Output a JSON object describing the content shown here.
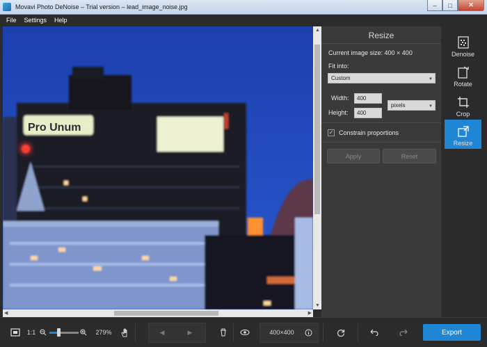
{
  "window": {
    "title": "Movavi Photo DeNoise – Trial version – lead_image_noise.jpg",
    "minimize": "–",
    "maximize": "□",
    "close": "✕"
  },
  "menu": {
    "items": [
      "File",
      "Settings",
      "Help"
    ]
  },
  "panel": {
    "title": "Resize",
    "current_size_label": "Current image size: 400 × 400",
    "fit_into_label": "Fit into:",
    "fit_into_value": "Custom",
    "width_label": "Width:",
    "width_value": "400",
    "height_label": "Height:",
    "height_value": "400",
    "units_value": "pixels",
    "constrain_label": "Constrain proportions",
    "constrain_checked": true,
    "apply_label": "Apply",
    "reset_label": "Reset"
  },
  "tools": {
    "items": [
      {
        "label": "Denoise",
        "icon": "denoise-icon",
        "active": false
      },
      {
        "label": "Rotate",
        "icon": "rotate-icon",
        "active": false
      },
      {
        "label": "Crop",
        "icon": "crop-icon",
        "active": false
      },
      {
        "label": "Resize",
        "icon": "resize-icon",
        "active": true
      }
    ]
  },
  "toolbar": {
    "zoom_label": "1:1",
    "zoom_percent": "279%",
    "zoom_level_fraction": 0.3,
    "image_size": "400×400",
    "export_label": "Export"
  },
  "image": {
    "sign_text": "Pro Unum"
  },
  "colors": {
    "accent": "#1f86d6",
    "panel_bg": "#3a3a3a",
    "app_bg": "#2b2b2b"
  }
}
